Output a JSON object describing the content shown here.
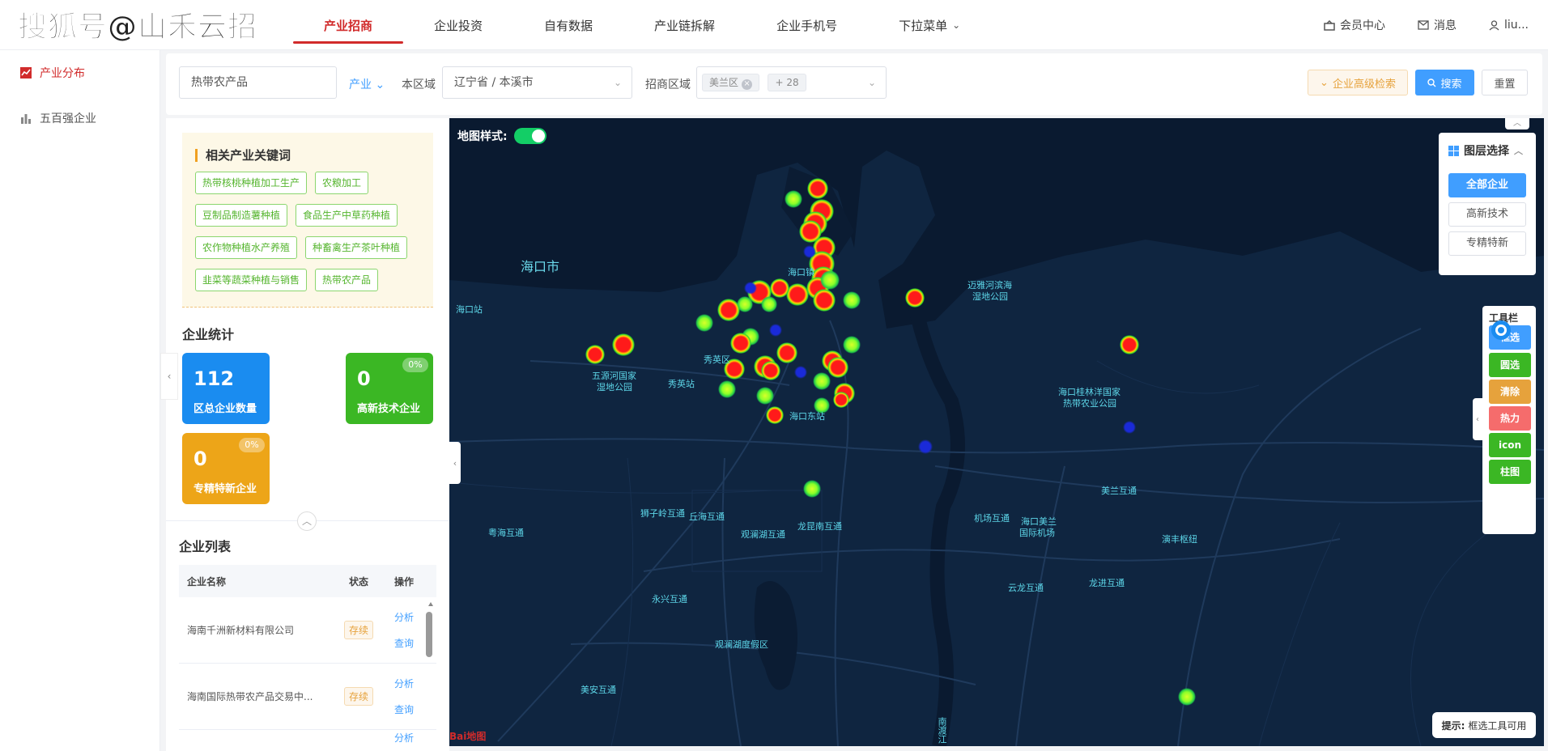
{
  "watermark": "搜狐号@山禾云招",
  "nav": {
    "items": [
      "产业招商",
      "企业投资",
      "自有数据",
      "产业链拆解",
      "企业手机号",
      "下拉菜单"
    ],
    "active_index": 0
  },
  "top_right": {
    "member": "会员中心",
    "messages": "消息",
    "user": "liu..."
  },
  "sidebar": {
    "items": [
      {
        "label": "产业分布",
        "icon": "line-chart-icon",
        "active": true
      },
      {
        "label": "五百强企业",
        "icon": "bar-chart-icon",
        "active": false
      }
    ]
  },
  "filter": {
    "keyword_value": "热带农产品",
    "industry_label": "产业",
    "local_region_label": "本区域",
    "local_region_value": "辽宁省 / 本溪市",
    "target_region_label": "招商区域",
    "target_region_tag": "美兰区",
    "target_region_more": "+ 28",
    "advanced_search": "企业高级检索",
    "search": "搜索",
    "reset": "重置"
  },
  "keywords": {
    "title": "相关产业关键词",
    "tags": [
      "热带核桃种植加工生产",
      "农粮加工",
      "豆制品制造薯种植",
      "食品生产中草药种植",
      "农作物种植水产养殖",
      "种畜禽生产茶叶种植",
      "韭菜等蔬菜种植与销售",
      "热带农产品"
    ]
  },
  "stats": {
    "title": "企业统计",
    "cards": [
      {
        "value": "112",
        "label": "区总企业数量",
        "badge": ""
      },
      {
        "value": "0",
        "label": "高新技术企业",
        "badge": "0%"
      },
      {
        "value": "0",
        "label": "专精特新企业",
        "badge": "0%"
      }
    ]
  },
  "company_list": {
    "title": "企业列表",
    "headers": [
      "企业名称",
      "状态",
      "操作"
    ],
    "rows": [
      {
        "name": "海南千洲新材料有限公司",
        "status": "存续",
        "op1": "分析",
        "op2": "查询"
      },
      {
        "name": "海南国际热带农产品交易中...",
        "status": "存续",
        "op1": "分析",
        "op2": "查询"
      },
      {
        "name": "",
        "status": "",
        "op1": "分析",
        "op2": ""
      }
    ]
  },
  "map": {
    "style_label": "地图样式:",
    "labels": {
      "haikou": "海口市",
      "haikou_station": "海口站",
      "wuyuan": "五源河国家",
      "wuyuan2": "湿地公园",
      "xiuying_station": "秀英站",
      "xiuying": "秀英区",
      "haikou_east": "海口东站",
      "haikou_town": "海口镇",
      "maiya": "迈雅河滨海",
      "maiya2": "湿地公园",
      "guilin": "海口桂林洋国家",
      "guilin2": "热带农业公园",
      "shizi": "狮子岭互通",
      "qiuhai": "丘海互通",
      "yuehai": "粤海互通",
      "guanlan": "观澜湖互通",
      "longkun": "龙昆南互通",
      "jichang": "机场互通",
      "meilan_airport": "海口美兰",
      "meilan_airport2": "国际机场",
      "meilan_hub": "美兰互通",
      "yanfeng": "演丰枢纽",
      "yunlong": "云龙互通",
      "longjin": "龙进互通",
      "yongxing": "永兴互通",
      "guanlan_resort": "观澜湖度假区",
      "meian": "美安互通",
      "nandu": "南渡江"
    },
    "layer_panel": {
      "title": "图层选择",
      "options": [
        "全部企业",
        "高新技术",
        "专精特新"
      ],
      "active_index": 0
    },
    "tools": {
      "title": "工具栏",
      "items": [
        {
          "label": "框选",
          "color": "#409eff"
        },
        {
          "label": "圆选",
          "color": "#3bb724"
        },
        {
          "label": "清除",
          "color": "#e6a23c"
        },
        {
          "label": "热力",
          "color": "#f56c6c"
        },
        {
          "label": "icon",
          "color": "#3bb724"
        },
        {
          "label": "柱图",
          "color": "#3bb724"
        }
      ]
    },
    "hint_label": "提示:",
    "hint_text": "框选工具可用",
    "attribution": "Bai地图"
  }
}
